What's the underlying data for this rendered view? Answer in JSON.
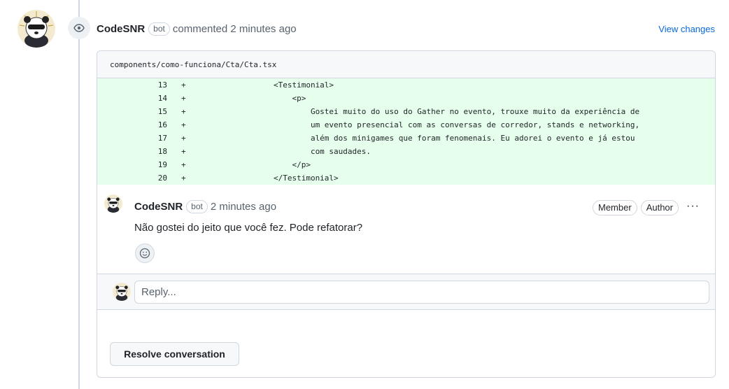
{
  "header": {
    "author": "CodeSNR",
    "bot_badge": "bot",
    "action": "commented 2 minutes ago",
    "view_changes": "View changes"
  },
  "file": {
    "path": "components/como-funciona/Cta/Cta.tsx",
    "lines": [
      {
        "num": "13",
        "sign": "+",
        "code": "                <Testimonial>"
      },
      {
        "num": "14",
        "sign": "+",
        "code": "                    <p>"
      },
      {
        "num": "15",
        "sign": "+",
        "code": "                        Gostei muito do uso do Gather no evento, trouxe muito da experiência de"
      },
      {
        "num": "16",
        "sign": "+",
        "code": "                        um evento presencial com as conversas de corredor, stands e networking,"
      },
      {
        "num": "17",
        "sign": "+",
        "code": "                        além dos minigames que foram fenomenais. Eu adorei o evento e já estou"
      },
      {
        "num": "18",
        "sign": "+",
        "code": "                        com saudades."
      },
      {
        "num": "19",
        "sign": "+",
        "code": "                    </p>"
      },
      {
        "num": "20",
        "sign": "+",
        "code": "                </Testimonial>"
      }
    ]
  },
  "comment": {
    "author": "CodeSNR",
    "bot_badge": "bot",
    "time": "2 minutes ago",
    "roles": [
      "Member",
      "Author"
    ],
    "more": "···",
    "body": "Não gostei do jeito que você fez. Pode refatorar?"
  },
  "reply": {
    "placeholder": "Reply..."
  },
  "resolve_label": "Resolve conversation",
  "icons": {
    "eye": "eye-icon",
    "smiley": "smiley-icon",
    "avatar": "panda-avatar"
  }
}
